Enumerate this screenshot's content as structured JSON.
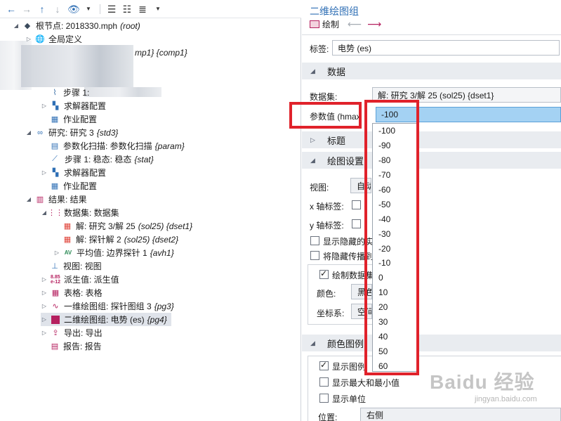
{
  "toolbar": {
    "icons": [
      "arrow-left-icon",
      "arrow-right-icon",
      "arrow-up-icon",
      "arrow-down-icon",
      "eye-icon",
      "expand-tree-icon",
      "collapse-tree-icon",
      "menu-icon"
    ]
  },
  "tree": {
    "root_label": "根节点: 2018330.mph",
    "root_tag": "(root)",
    "global_defs": "全局定义",
    "comp_tag": "mp1} {comp1}",
    "step1_label": "步骤 1:",
    "solver_config_1": "求解器配置",
    "job_config_1": "作业配置",
    "study3_label": "研究: 研究 3",
    "study3_tag": "{std3}",
    "param_sweep_label": "参数化扫描: 参数化扫描",
    "param_sweep_tag": "{param}",
    "step1_stat_label": "步骤 1: 稳态: 稳态",
    "step1_stat_tag": "{stat}",
    "solver_config_2": "求解器配置",
    "job_config_2": "作业配置",
    "results_label": "结果: 结果",
    "datasets_label": "数据集: 数据集",
    "dset1_label": "解: 研究 3/解 25",
    "dset1_tag": "(sol25) {dset1}",
    "dset2_label": "解: 探针解 2",
    "dset2_tag": "(sol25) {dset2}",
    "avh1_label": "平均值: 边界探针 1",
    "avh1_tag": "{avh1}",
    "view_label": "视图: 视图",
    "derived_label": "派生值: 派生值",
    "tables_label": "表格: 表格",
    "pg3_label": "一维绘图组: 探针图组 3",
    "pg3_tag": "{pg3}",
    "pg4_label": "二维绘图组: 电势 (es)",
    "pg4_tag": "{pg4}",
    "export_label": "导出: 导出",
    "report_label": "报告: 报告"
  },
  "panel": {
    "title": "二维绘图组",
    "plot_label": "绘制",
    "label_field_label": "标签:",
    "label_field_value": "电势 (es)",
    "data_section": "数据",
    "dataset_label": "数据集:",
    "dataset_value": "解: 研究 3/解 25 (sol25) {dset1}",
    "param_label": "参数值 (hmax",
    "param_value": "-100",
    "title_section": "标题",
    "plot_settings_section": "绘图设置",
    "view_label": "视图:",
    "view_value": "自动",
    "xaxis_label": "x 轴标签:",
    "yaxis_label": "y 轴标签:",
    "show_hidden": "显示隐藏的实",
    "propagate_hidden": "将隐藏传播到",
    "plot_dataset_edges": "绘制数据集",
    "color_label": "颜色:",
    "color_value": "黑色",
    "coord_label": "坐标系:",
    "coord_value": "空间",
    "color_legend_section": "颜色图例",
    "show_legend": "显示图例",
    "show_maxmin": "显示最大和最小值",
    "show_units": "显示单位",
    "position_label": "位置:",
    "position_value": "右侧"
  },
  "dropdown": {
    "options": [
      "-100",
      "-90",
      "-80",
      "-70",
      "-60",
      "-50",
      "-40",
      "-30",
      "-20",
      "-10",
      "0",
      "10",
      "20",
      "30",
      "40",
      "50",
      "60"
    ]
  },
  "watermark": {
    "text": "Baidu 经验",
    "url": "jingyan.baidu.com"
  },
  "colors": {
    "accent": "#2f6fb5",
    "highlight": "#e0222b",
    "selection": "#a4d2f3",
    "pg4": "#b5205f"
  }
}
